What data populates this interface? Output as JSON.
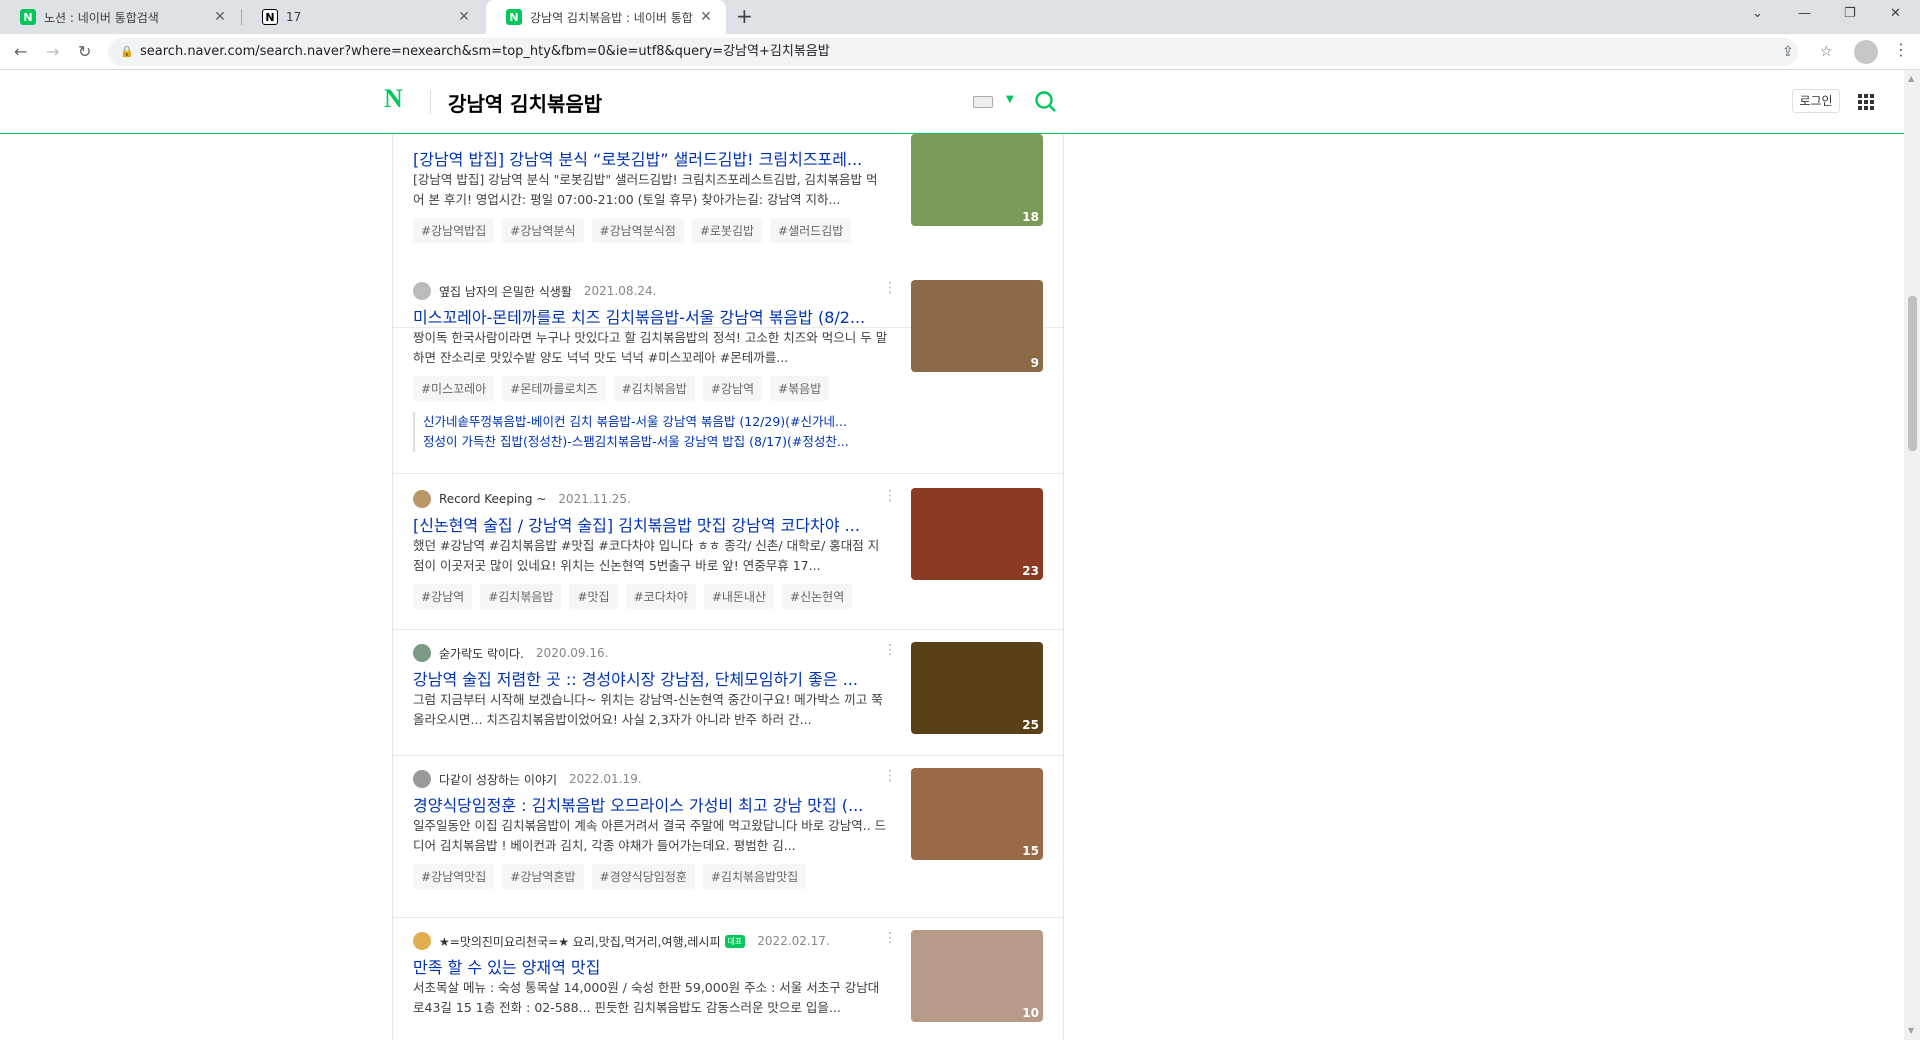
{
  "browser": {
    "tabs": [
      {
        "title": "노션 : 네이버 통합검색",
        "icon": "naver"
      },
      {
        "title": "17",
        "icon": "notion"
      },
      {
        "title": "강남역 김치볶음밥 : 네이버 통합",
        "icon": "naver",
        "active": true
      }
    ],
    "url": "search.naver.com/search.naver?where=nexearch&sm=top_hty&fbm=0&ie=utf8&query=강남역+김치볶음밥"
  },
  "header": {
    "query": "강남역 김치볶음밥",
    "login_label": "로그인"
  },
  "results": [
    {
      "title": "[강남역 밥집] 강남역 분식 “로봇김밥” 샐러드김밥! 크림치즈포레...",
      "desc": "[강남역 밥집] 강남역 분식 \"로봇김밥\" 샐러드김밥! 크림치즈포레스트김밥, 김치볶음밥 먹어 본 후기! 영업시간: 평일 07:00-21:00 (토일 휴무) 찾아가는길: 강남역 지하...",
      "tags": [
        "#강남역밥집",
        "#강남역분식",
        "#강남역분식점",
        "#로봇김밥",
        "#샐러드김밥"
      ],
      "count": "18",
      "img": "#7a9a58"
    },
    {
      "author": "옆집 남자의 은밀한 식생활",
      "date": "2021.08.24.",
      "title": "미스꼬레아-몬테까를로 치즈 김치볶음밥-서울 강남역 볶음밥 (8/2...",
      "desc": "짱이독 한국사람이라면 누구나 맛있다고 할 김치볶음밥의 정석! 고소한 치즈와 먹으니 두 말하면 잔소리로 맛있수밭 양도 넉넉 맛도 넉넉 #미스꼬레아 #몬테까를...",
      "tags": [
        "#미스꼬레아",
        "#몬테까를로치즈",
        "#김치볶음밥",
        "#강남역",
        "#볶음밥"
      ],
      "sublinks": [
        "신가네솥뚜껑볶음밥-베이컨 김치 볶음밥-서울 강남역 볶음밥 (12/29)(#신가네...",
        "정성이 가득찬 집밥(정성찬)-스팸김치볶음밥-서울 강남역 밥집 (8/17)(#정성찬..."
      ],
      "count": "9",
      "img": "#8c6a48"
    },
    {
      "author": "Record Keeping ~",
      "date": "2021.11.25.",
      "title": "[신논현역 술집 / 강남역 술집] 김치볶음밥 맛집 강남역 코다차야 ...",
      "desc": "했던 #강남역 #김치볶음밥 #맛집 #코다차야 입니다 ㅎㅎ 종각/ 신촌/ 대학로/ 홍대점 지점이 이곳저곳 많이 있네요! 위치는 신논현역 5번출구 바로 앞! 연중무휴 17...",
      "tags": [
        "#강남역",
        "#김치볶음밥",
        "#맛집",
        "#코다차야",
        "#내돈내산",
        "#신논현역"
      ],
      "count": "23",
      "img": "#8a3a22"
    },
    {
      "author": "숟가락도 락이다.",
      "date": "2020.09.16.",
      "title": "강남역 술집 저렴한 곳 :: 경성야시장 강남점, 단체모임하기 좋은 ...",
      "desc": "그럼 지금부터 시작해 보겠습니다~ 위치는 강남역-신논현역 중간이구요! 메가박스 끼고 쭉 올라오시면... 치즈김치볶음밥이었어요! 사실 2,3자가 아니라 반주 하러 간...",
      "tags": [],
      "count": "25",
      "img": "#5a4018"
    },
    {
      "author": "다같이 성장하는 이야기",
      "date": "2022.01.19.",
      "title": "경양식당임정훈 : 김치볶음밥 오므라이스 가성비 최고 강남 맛집 (...",
      "desc": "일주일동안 이집 김치볶음밥이 계속 아른거려서 결국 주말에 먹고왔답니다 바로 강남역.. 드디어 김치볶음밥 ! 베이컨과 김치, 각종 야채가 들어가는데요. 평범한 김...",
      "tags": [
        "#강남역맛집",
        "#강남역혼밥",
        "#경양식당임정훈",
        "#김치볶음밥맛집"
      ],
      "count": "15",
      "img": "#9a6a48"
    },
    {
      "author": "★=맛의진미요리천국=★ 요리,맛집,먹거리,여행,레시피",
      "badge": "대표",
      "date": "2022.02.17.",
      "title": "만족 할 수 있는 양재역 맛집",
      "desc": "서초목살 메뉴 : 숙성 통목살 14,000원 / 숙성 한판 59,000원 주소 : 서울 서초구 강남대로43길 15 1층 전화 : 02-588... 핀듯한 김치볶음밥도 감동스러운 맛으로 입을...",
      "tags": [],
      "count": "10",
      "img": "#b89a88"
    }
  ]
}
